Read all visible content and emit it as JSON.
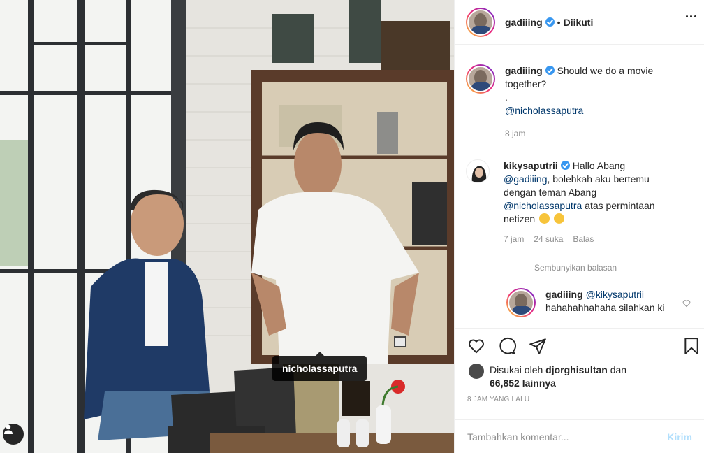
{
  "post": {
    "author": "gadiiing",
    "follow_separator": "•",
    "follow_state": "Diikuti",
    "photo_tag": "nicholassaputra"
  },
  "caption": {
    "username": "gadiiing",
    "text": "Should we do a movie together?",
    "dot": ".",
    "mention": "@nicholassaputra",
    "time": "8 jam"
  },
  "comment1": {
    "username": "kikysaputrii",
    "text_a": "Hallo Abang",
    "mention_a": "@gadiiing",
    "text_b": ", bolehkah aku bertemu dengan teman Abang",
    "mention_b": "@nicholassaputra",
    "text_c": "atas permintaan netizen",
    "time": "7 jam",
    "likes": "24 suka",
    "reply": "Balas"
  },
  "hide_replies": "Sembunyikan balasan",
  "reply1": {
    "username": "gadiiing",
    "mention": "@kikysaputrii",
    "text": "hahahahhahaha silahkan ki"
  },
  "likes": {
    "prefix": "Disukai oleh",
    "user": "djorghisultan",
    "conj": "dan",
    "count": "66,852 lainnya"
  },
  "time_ago": "8 JAM YANG LALU",
  "comment_input": {
    "placeholder": "Tambahkan komentar...",
    "post_label": "Kirim"
  },
  "colors": {
    "verified": "#3897f0",
    "mention": "#00376b",
    "muted": "#8e8e8e",
    "post_disabled": "#b2dffc"
  },
  "icons": [
    "user-tag-icon",
    "verified-badge-icon",
    "more-options-icon",
    "heart-icon",
    "comment-icon",
    "share-icon",
    "bookmark-icon",
    "emoji-icon"
  ]
}
